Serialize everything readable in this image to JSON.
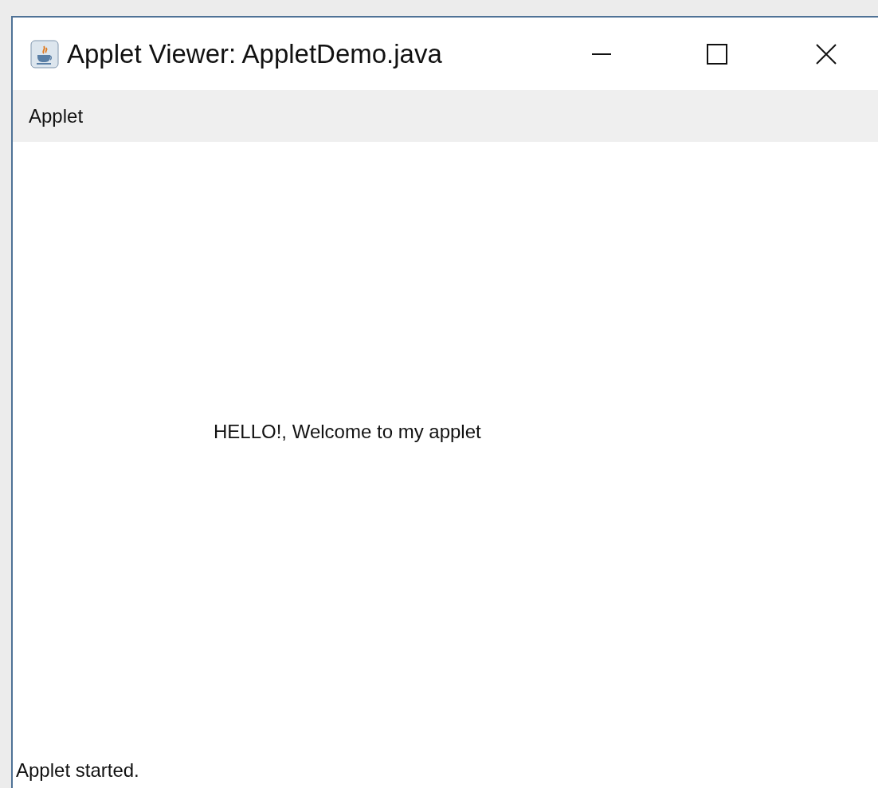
{
  "window": {
    "title": "Applet Viewer: AppletDemo.java"
  },
  "menu_bar": {
    "items": [
      "Applet"
    ]
  },
  "applet": {
    "message": "HELLO!, Welcome to my applet"
  },
  "status_bar": {
    "text": "Applet started."
  }
}
